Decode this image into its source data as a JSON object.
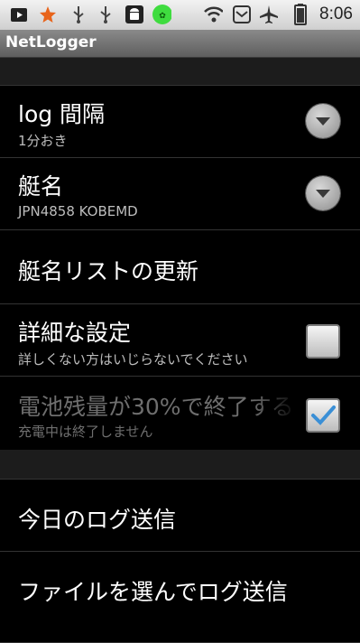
{
  "status_bar": {
    "time": "8:06",
    "icons": [
      "play-store-icon",
      "star-icon",
      "usb-icon",
      "usb-icon",
      "android-debug-icon",
      "green-app-icon",
      "wifi-icon",
      "notification-icon",
      "airplane-icon",
      "battery-icon"
    ]
  },
  "app": {
    "title": "NetLogger"
  },
  "preferences": [
    {
      "title": "log 間隔",
      "summary": "1分おき",
      "control": "dropdown"
    },
    {
      "title": "艇名",
      "summary": "JPN4858 KOBEMD",
      "control": "dropdown"
    },
    {
      "title": "艇名リストの更新"
    },
    {
      "title": "詳細な設定",
      "summary": "詳しくない方はいじらないでください",
      "control": "checkbox",
      "checked": false
    },
    {
      "title": "電池残量が30%で終了する",
      "summary": "充電中は終了しません",
      "control": "checkbox",
      "checked": true,
      "enabled": false
    }
  ],
  "actions": [
    {
      "title": "今日のログ送信"
    },
    {
      "title": "ファイルを選んでログ送信"
    }
  ],
  "colors": {
    "accent_check": "#3a8fd6",
    "disabled_text": "#6e6e6e"
  }
}
